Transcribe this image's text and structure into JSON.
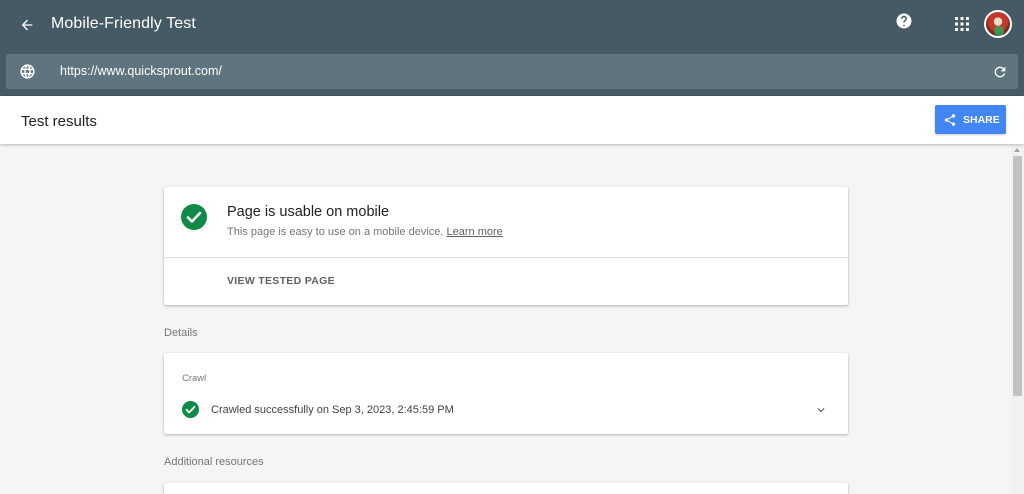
{
  "app": {
    "title": "Mobile-Friendly Test",
    "back_icon": "arrow-back-icon",
    "help_icon": "help-icon",
    "apps_icon": "apps-grid-icon",
    "avatar_icon": "user-avatar"
  },
  "urlbar": {
    "url": "https://www.quicksprout.com/",
    "globe_icon": "globe-icon",
    "reload_icon": "reload-icon"
  },
  "results_header": {
    "title": "Test results",
    "share_label": "SHARE",
    "share_icon": "share-icon"
  },
  "usable_card": {
    "title": "Page is usable on mobile",
    "description": "This page is easy to use on a mobile device.",
    "learn_more": "Learn more",
    "view_tested_label": "VIEW TESTED PAGE",
    "status_icon": "check-circle-icon"
  },
  "details": {
    "label": "Details",
    "crawl": {
      "label": "Crawl",
      "status": "Crawled successfully on Sep 3, 2023, 2:45:59 PM",
      "status_icon": "check-circle-icon",
      "expand_icon": "chevron-down-icon"
    }
  },
  "additional": {
    "label": "Additional resources"
  },
  "colors": {
    "topbar": "#455a64",
    "urlbar": "#5f747e",
    "accent": "#4285f4",
    "success": "#0f9d58"
  }
}
